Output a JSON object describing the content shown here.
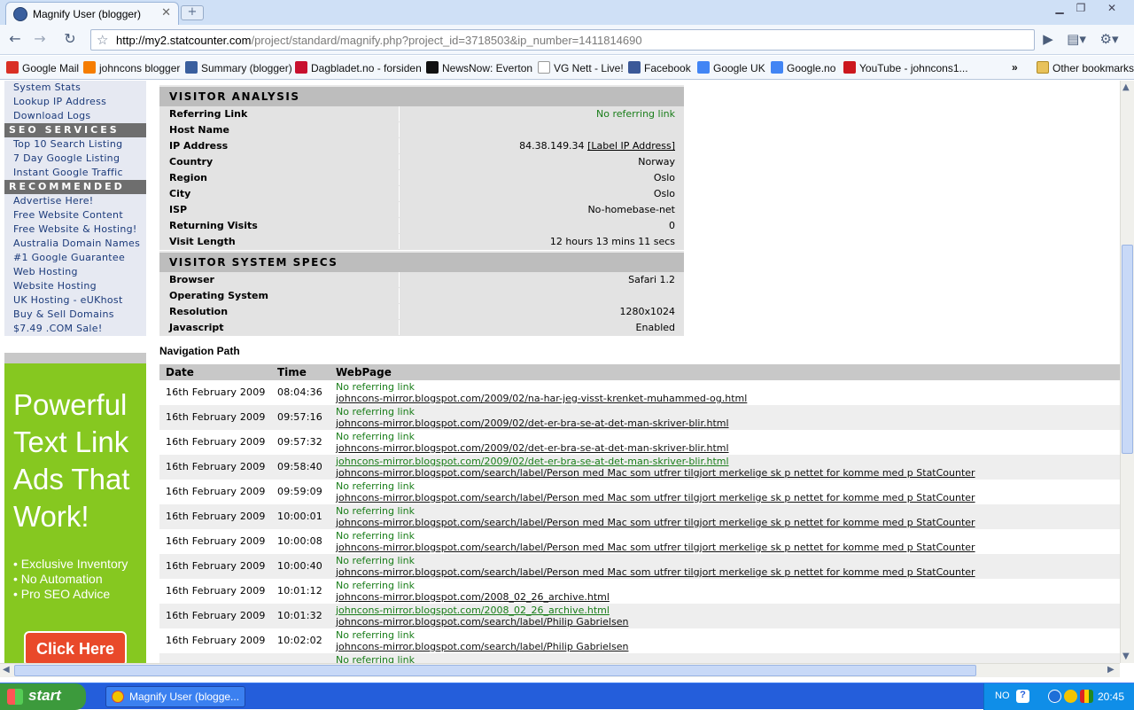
{
  "browser": {
    "tab_title": "Magnify User (blogger)",
    "url_host": "http://my2.statcounter.com",
    "url_path": "/project/standard/magnify.php?project_id=3718503&ip_number=1411814690",
    "bookmarks": [
      {
        "label": "Google Mail",
        "icon": "gmail-icon",
        "color": "#d93025"
      },
      {
        "label": "johncons blogger",
        "icon": "blogger-icon",
        "color": "#f57d00"
      },
      {
        "label": "Summary (blogger)",
        "icon": "statcounter-icon",
        "color": "#3a5f9e"
      },
      {
        "label": "Dagbladet.no - forsiden",
        "icon": "dagbladet-icon",
        "color": "#c8102e"
      },
      {
        "label": "NewsNow: Everton",
        "icon": "newsnow-icon",
        "color": "#111111"
      },
      {
        "label": "VG Nett - Live!",
        "icon": "page-icon",
        "color": "#ffffff"
      },
      {
        "label": "Facebook",
        "icon": "facebook-icon",
        "color": "#3b5998"
      },
      {
        "label": "Google UK",
        "icon": "google-icon",
        "color": "#4285f4"
      },
      {
        "label": "Google.no",
        "icon": "google-icon",
        "color": "#4285f4"
      },
      {
        "label": "YouTube - johncons1...",
        "icon": "youtube-icon",
        "color": "#cc181e"
      }
    ],
    "overflow": "»",
    "other_bookmarks": "Other bookmarks"
  },
  "sidebar": {
    "top_items": [
      "System Stats",
      "Lookup IP Address",
      "Download Logs"
    ],
    "seo_heading": "SEO SERVICES",
    "seo_items": [
      "Top 10 Search Listing",
      "7 Day Google Listing",
      "Instant Google Traffic"
    ],
    "rec_heading": "RECOMMENDED",
    "rec_items": [
      "Advertise Here!",
      "Free Website Content",
      "Free Website & Hosting!",
      "Australia Domain Names",
      "#1 Google Guarantee",
      "Web Hosting",
      "Website Hosting",
      "UK Hosting - eUKhost",
      "Buy & Sell Domains",
      "$7.49 .COM Sale!"
    ]
  },
  "ad": {
    "headline_1": "Powerful",
    "headline_2": "Text Link",
    "headline_3": "Ads That",
    "headline_4": "Work!",
    "bullets": [
      "• Exclusive Inventory",
      "• No Automation",
      "• Pro SEO Advice"
    ],
    "button": "Click Here"
  },
  "visitor_analysis": {
    "heading": "VISITOR ANALYSIS",
    "rows": [
      {
        "label": "Referring Link",
        "value": "No referring link"
      },
      {
        "label": "Host Name",
        "value": ""
      },
      {
        "label": "IP Address",
        "value": "84.38.149.34",
        "link": "[Label IP Address]"
      },
      {
        "label": "Country",
        "value": "Norway"
      },
      {
        "label": "Region",
        "value": "Oslo"
      },
      {
        "label": "City",
        "value": "Oslo"
      },
      {
        "label": "ISP",
        "value": "No-homebase-net"
      },
      {
        "label": "Returning Visits",
        "value": "0"
      },
      {
        "label": "Visit Length",
        "value": "12 hours 13 mins 11 secs"
      }
    ]
  },
  "system_specs": {
    "heading": "VISITOR SYSTEM SPECS",
    "rows": [
      {
        "label": "Browser",
        "value": "Safari 1.2"
      },
      {
        "label": "Operating System",
        "value": ""
      },
      {
        "label": "Resolution",
        "value": "1280x1024"
      },
      {
        "label": "Javascript",
        "value": "Enabled"
      }
    ]
  },
  "navigation": {
    "title": "Navigation Path",
    "columns": [
      "Date",
      "Time",
      "WebPage"
    ],
    "rows": [
      {
        "date": "16th February 2009",
        "time": "08:04:36",
        "ref": "No referring link",
        "ref_is_link": false,
        "page": "johncons-mirror.blogspot.com/2009/02/na-har-jeg-visst-krenket-muhammed-og.html"
      },
      {
        "date": "16th February 2009",
        "time": "09:57:16",
        "ref": "No referring link",
        "ref_is_link": false,
        "page": "johncons-mirror.blogspot.com/2009/02/det-er-bra-se-at-det-man-skriver-blir.html"
      },
      {
        "date": "16th February 2009",
        "time": "09:57:32",
        "ref": "No referring link",
        "ref_is_link": false,
        "page": "johncons-mirror.blogspot.com/2009/02/det-er-bra-se-at-det-man-skriver-blir.html"
      },
      {
        "date": "16th February 2009",
        "time": "09:58:40",
        "ref": "johncons-mirror.blogspot.com/2009/02/det-er-bra-se-at-det-man-skriver-blir.html",
        "ref_is_link": true,
        "page": "johncons-mirror.blogspot.com/search/label/Person med Mac som utfrer tilgjort merkelige sk p nettet for komme med p StatCounter"
      },
      {
        "date": "16th February 2009",
        "time": "09:59:09",
        "ref": "No referring link",
        "ref_is_link": false,
        "page": "johncons-mirror.blogspot.com/search/label/Person med Mac som utfrer tilgjort merkelige sk p nettet for komme med p StatCounter"
      },
      {
        "date": "16th February 2009",
        "time": "10:00:01",
        "ref": "No referring link",
        "ref_is_link": false,
        "page": "johncons-mirror.blogspot.com/search/label/Person med Mac som utfrer tilgjort merkelige sk p nettet for komme med p StatCounter"
      },
      {
        "date": "16th February 2009",
        "time": "10:00:08",
        "ref": "No referring link",
        "ref_is_link": false,
        "page": "johncons-mirror.blogspot.com/search/label/Person med Mac som utfrer tilgjort merkelige sk p nettet for komme med p StatCounter"
      },
      {
        "date": "16th February 2009",
        "time": "10:00:40",
        "ref": "No referring link",
        "ref_is_link": false,
        "page": "johncons-mirror.blogspot.com/search/label/Person med Mac som utfrer tilgjort merkelige sk p nettet for komme med p StatCounter"
      },
      {
        "date": "16th February 2009",
        "time": "10:01:12",
        "ref": "No referring link",
        "ref_is_link": false,
        "page": "johncons-mirror.blogspot.com/2008_02_26_archive.html"
      },
      {
        "date": "16th February 2009",
        "time": "10:01:32",
        "ref": "johncons-mirror.blogspot.com/2008_02_26_archive.html",
        "ref_is_link": true,
        "page": "johncons-mirror.blogspot.com/search/label/Philip Gabrielsen"
      },
      {
        "date": "16th February 2009",
        "time": "10:02:02",
        "ref": "No referring link",
        "ref_is_link": false,
        "page": "johncons-mirror.blogspot.com/search/label/Philip Gabrielsen"
      },
      {
        "date": "",
        "time": "",
        "ref": "No referring link",
        "ref_is_link": false,
        "page": ""
      }
    ]
  },
  "taskbar": {
    "start": "start",
    "window_item": "Magnify User (blogge...",
    "lang": "NO",
    "clock": "20:45"
  }
}
